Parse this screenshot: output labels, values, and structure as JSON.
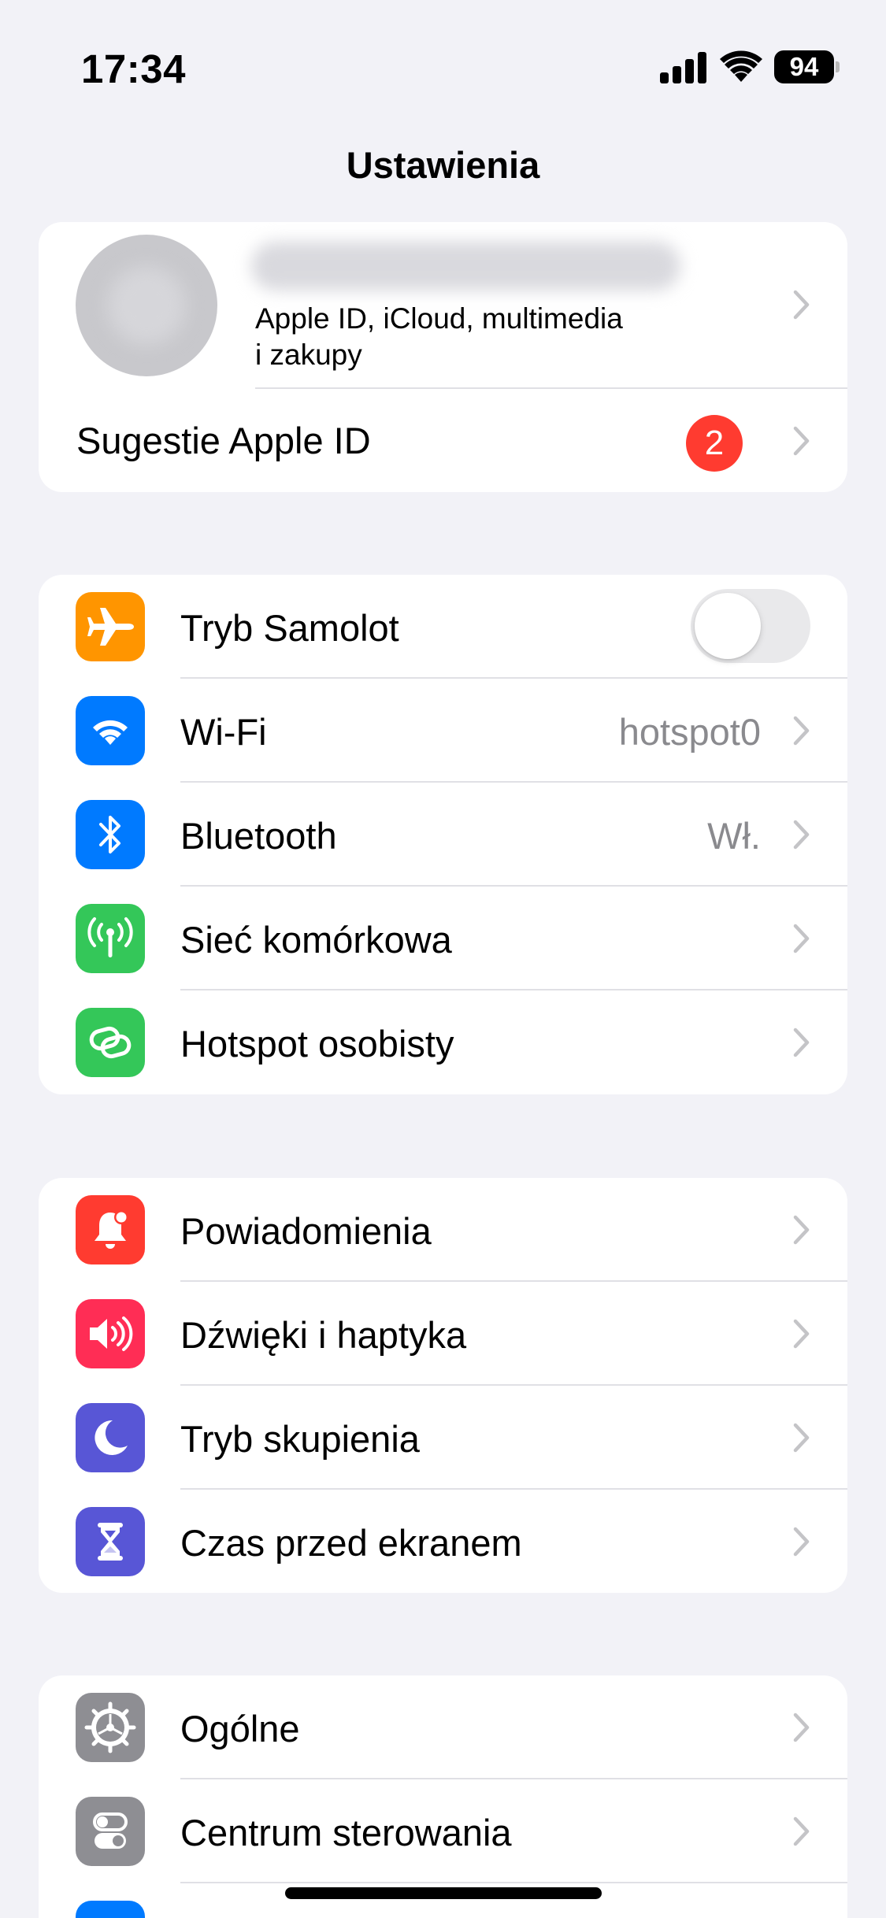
{
  "status_bar": {
    "time": "17:34",
    "battery": "94",
    "icons": [
      "cellular-signal-icon",
      "wifi-icon",
      "battery-icon"
    ]
  },
  "nav": {
    "title": "Ustawienia"
  },
  "profile": {
    "subtitle_line1": "Apple ID, iCloud, multimedia",
    "subtitle_line2": "i zakupy",
    "suggestions_label": "Sugestie Apple ID",
    "suggestions_badge": "2"
  },
  "connectivity": [
    {
      "label": "Tryb Samolot",
      "icon": "airplane-icon",
      "color": "#FF9500",
      "toggle": false
    },
    {
      "label": "Wi-Fi",
      "icon": "wifi-icon",
      "color": "#007AFF",
      "value": "hotspot0"
    },
    {
      "label": "Bluetooth",
      "icon": "bluetooth-icon",
      "color": "#007AFF",
      "value": "Wł."
    },
    {
      "label": "Sieć komórkowa",
      "icon": "antenna-icon",
      "color": "#34C759"
    },
    {
      "label": "Hotspot osobisty",
      "icon": "link-icon",
      "color": "#34C759"
    }
  ],
  "notifications": [
    {
      "label": "Powiadomienia",
      "icon": "bell-icon",
      "color": "#FF3B30"
    },
    {
      "label": "Dźwięki i haptyka",
      "icon": "speaker-icon",
      "color": "#FF2D55"
    },
    {
      "label": "Tryb skupienia",
      "icon": "moon-icon",
      "color": "#5856D6"
    },
    {
      "label": "Czas przed ekranem",
      "icon": "hourglass-icon",
      "color": "#5856D6"
    }
  ],
  "general": [
    {
      "label": "Ogólne",
      "icon": "gear-icon",
      "color": "#8E8E93"
    },
    {
      "label": "Centrum sterowania",
      "icon": "switches-icon",
      "color": "#8E8E93"
    },
    {
      "label": "",
      "icon": "app-icon",
      "color": "#007AFF"
    }
  ]
}
